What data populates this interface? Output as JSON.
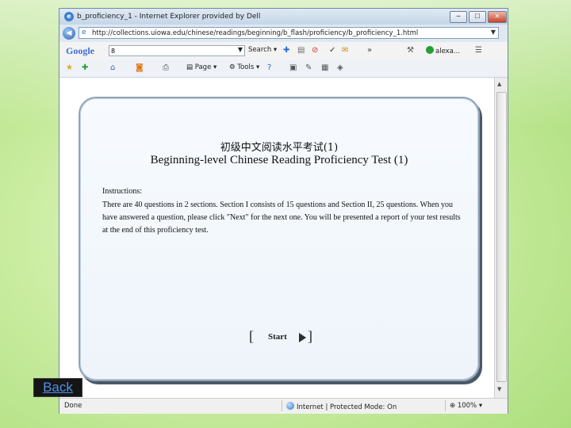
{
  "window": {
    "title": "b_proficiency_1 - Internet Explorer provided by Dell",
    "controls": {
      "minimize": "─",
      "maximize": "☐",
      "close": "✕"
    }
  },
  "address_bar": {
    "url": "http://collections.uiowa.edu/chinese/readings/beginning/b_flash/proficiency/b_proficiency_1.html"
  },
  "google_toolbar": {
    "logo": "Google",
    "search_value": "8",
    "search_label": "Search",
    "overflow": "»",
    "alexa_label": "alexa..."
  },
  "command_bar": {
    "page_label": "Page",
    "tools_label": "Tools"
  },
  "page": {
    "title_cn": "初级中文阅读水平考试(1)",
    "title_en": "Beginning-level Chinese Reading Proficiency Test (1)",
    "instructions_heading": "Instructions:",
    "instructions_body": "There are 40 questions in 2 sections. Section I consists of 15 questions and Section II, 25 questions. When you have answered a question, please click \"Next\" for the next one. You will be presented a report of your test results at the end of this proficiency test.",
    "start_label": "Start",
    "bracket_left": "[",
    "bracket_right": "]"
  },
  "status_bar": {
    "status": "Done",
    "zone": "Internet | Protected Mode: On",
    "zoom": "100%"
  },
  "slide": {
    "back_label": "Back"
  },
  "colors": {
    "background_green": "#c9ec9f",
    "link_blue": "#4f8fe8",
    "card_border": "#8fa4b8"
  },
  "icons": [
    "ie-icon",
    "back-icon",
    "favorites-icon",
    "home-icon",
    "rss-icon",
    "print-icon",
    "help-icon",
    "globe-icon"
  ]
}
